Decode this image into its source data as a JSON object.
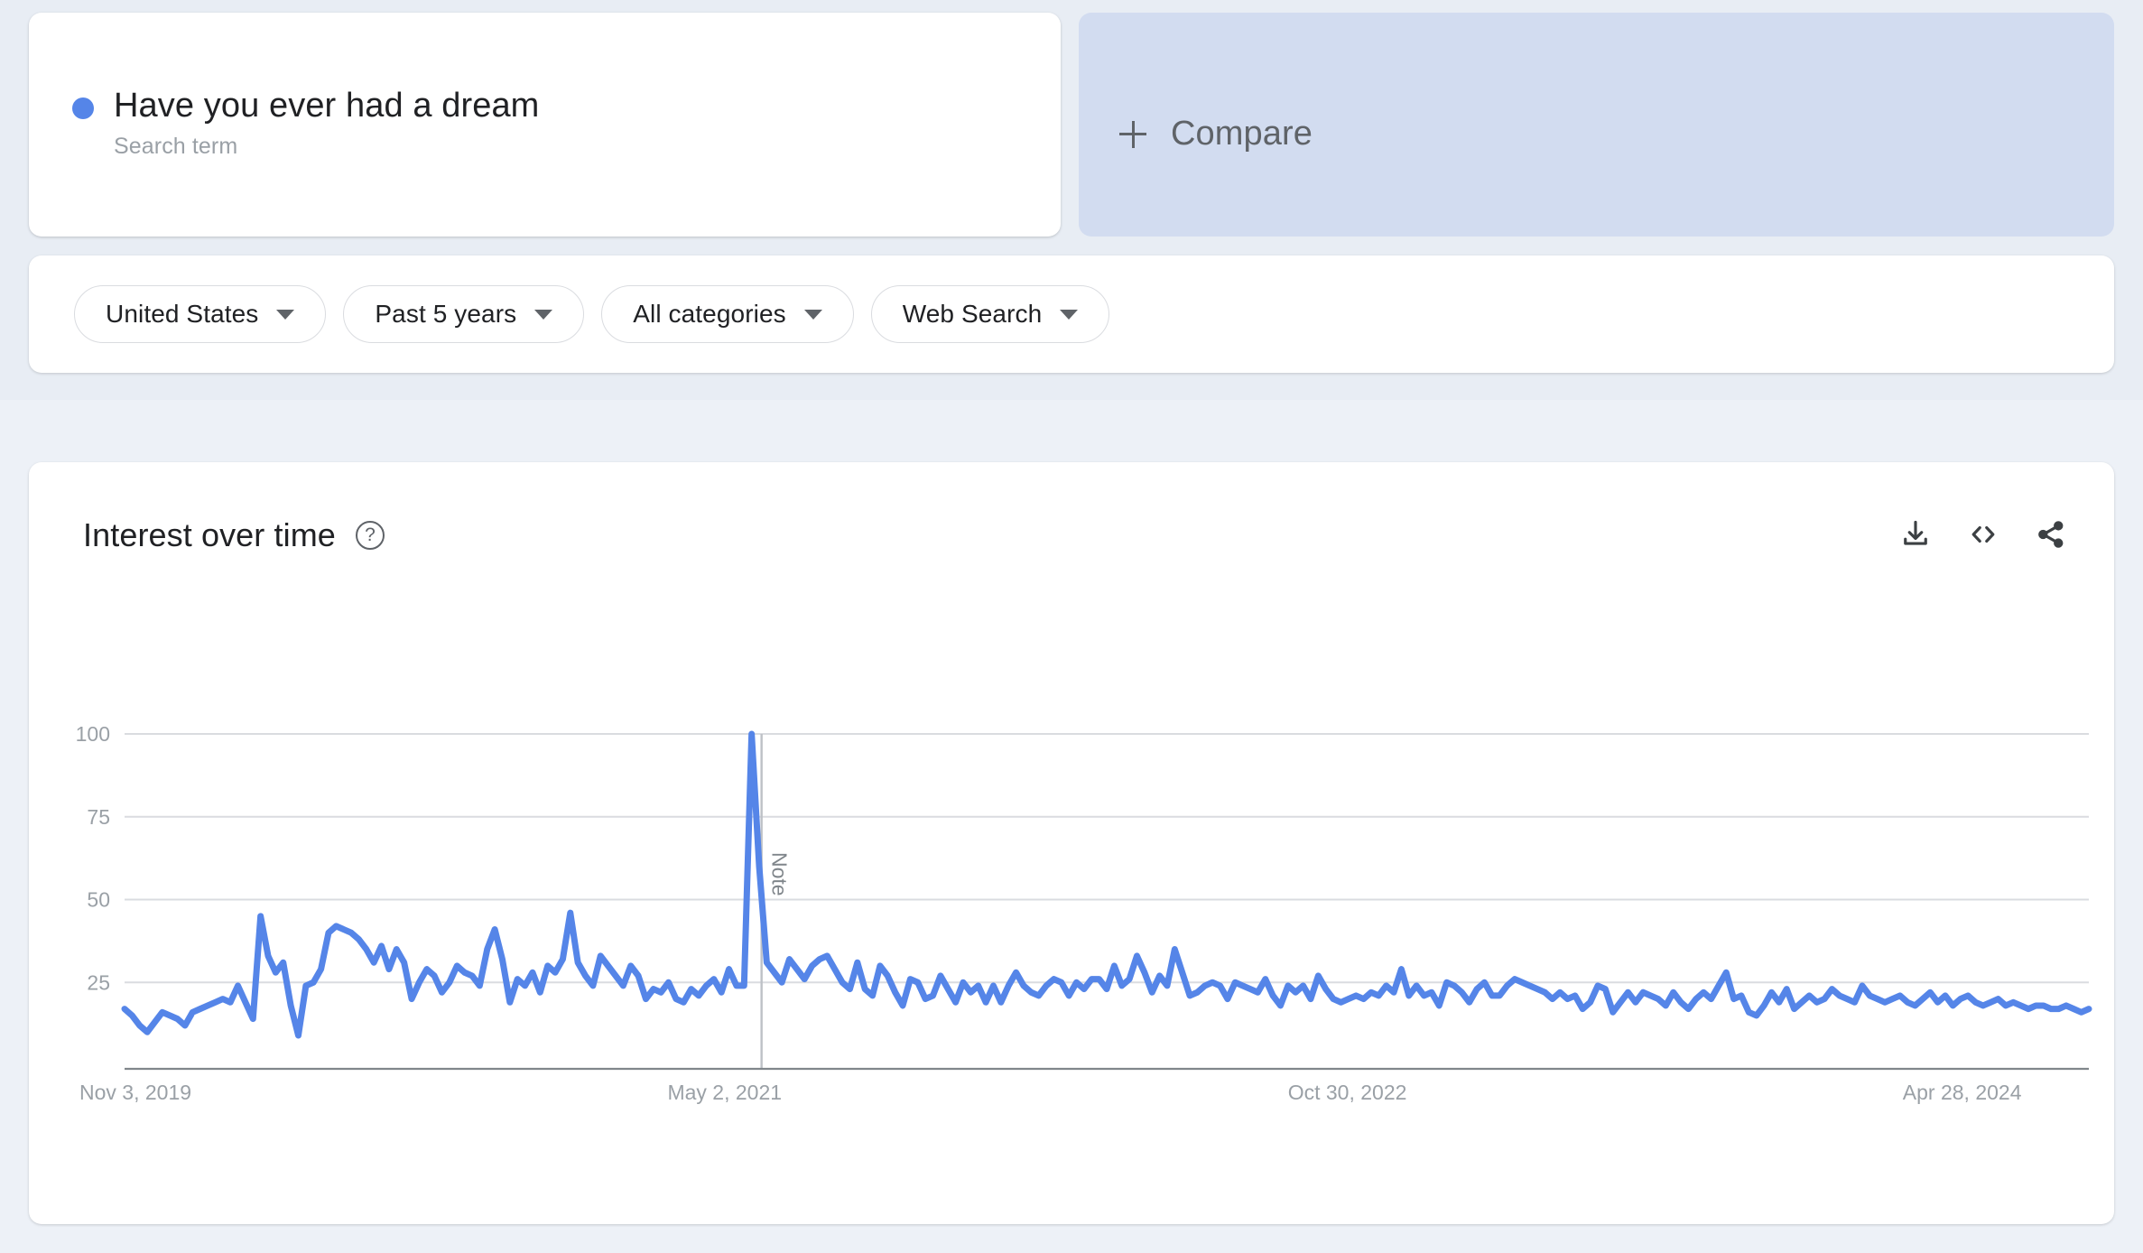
{
  "theme": {
    "background": "#e8edf3",
    "card_background": "#ffffff",
    "compare_background": "#d2dcf0",
    "series_color": "#5585e8",
    "text_primary": "#202124",
    "text_secondary": "#5f6368",
    "text_muted": "#9aa0a6",
    "gridline": "#dadce0"
  },
  "term": {
    "title": "Have you ever had a dream",
    "subtitle": "Search term",
    "dot_color": "#5585e8"
  },
  "compare": {
    "label": "Compare",
    "plus_icon": "plus-icon"
  },
  "filters": [
    {
      "label": "United States",
      "caret": "chevron-down-icon",
      "name": "region"
    },
    {
      "label": "Past 5 years",
      "caret": "chevron-down-icon",
      "name": "time-range"
    },
    {
      "label": "All categories",
      "caret": "chevron-down-icon",
      "name": "category"
    },
    {
      "label": "Web Search",
      "caret": "chevron-down-icon",
      "name": "search-type"
    }
  ],
  "chart_panel": {
    "title": "Interest over time",
    "help_icon": "help-circle-icon",
    "help_glyph": "?",
    "actions": [
      {
        "name": "download-icon",
        "label": "Download"
      },
      {
        "name": "embed-code-icon",
        "label": "Embed"
      },
      {
        "name": "share-icon",
        "label": "Share"
      }
    ]
  },
  "chart_data": {
    "type": "line",
    "title": "Interest over time",
    "xlabel": "",
    "ylabel": "",
    "ylim": [
      0,
      100
    ],
    "yticks": [
      100,
      75,
      50,
      25
    ],
    "grid": true,
    "legend": false,
    "xticks": [
      "Nov 3, 2019",
      "May 2, 2021",
      "Oct 30, 2022",
      "Apr 28, 2024"
    ],
    "xtick_positions": [
      0,
      0.5195,
      1.039,
      1.5585
    ],
    "xtick_unit": "fraction of 261 weekly points (tick 2,3,4 extrapolated beyond index range scale)",
    "annotations": [
      {
        "type": "vertical-line",
        "label": "Note",
        "x_index": 83,
        "color": "#bdc1c6"
      }
    ],
    "series": [
      {
        "name": "Have you ever had a dream",
        "color": "#5585e8",
        "values": [
          17,
          15,
          12,
          10,
          13,
          16,
          15,
          14,
          12,
          16,
          17,
          18,
          19,
          20,
          19,
          24,
          19,
          14,
          45,
          33,
          28,
          31,
          18,
          9,
          24,
          25,
          29,
          40,
          42,
          41,
          40,
          38,
          35,
          31,
          36,
          29,
          35,
          31,
          20,
          25,
          29,
          27,
          22,
          25,
          30,
          28,
          27,
          24,
          35,
          41,
          32,
          19,
          26,
          24,
          28,
          22,
          30,
          28,
          32,
          46,
          31,
          27,
          24,
          33,
          30,
          27,
          24,
          30,
          27,
          20,
          23,
          22,
          25,
          20,
          19,
          23,
          21,
          24,
          26,
          22,
          29,
          24,
          24,
          100,
          60,
          31,
          28,
          25,
          32,
          29,
          26,
          30,
          32,
          33,
          29,
          25,
          23,
          31,
          23,
          21,
          30,
          27,
          22,
          18,
          26,
          25,
          20,
          21,
          27,
          23,
          19,
          25,
          22,
          24,
          19,
          24,
          19,
          24,
          28,
          24,
          22,
          21,
          24,
          26,
          25,
          21,
          25,
          23,
          26,
          26,
          23,
          30,
          24,
          26,
          33,
          28,
          22,
          27,
          24,
          35,
          28,
          21,
          22,
          24,
          25,
          24,
          20,
          25,
          24,
          23,
          22,
          26,
          21,
          18,
          24,
          22,
          24,
          20,
          27,
          23,
          20,
          19,
          20,
          21,
          20,
          22,
          21,
          24,
          22,
          29,
          21,
          24,
          21,
          22,
          18,
          25,
          24,
          22,
          19,
          23,
          25,
          21,
          21,
          24,
          26,
          25,
          24,
          23,
          22,
          20,
          22,
          20,
          21,
          17,
          19,
          24,
          23,
          16,
          19,
          22,
          19,
          22,
          21,
          20,
          18,
          22,
          19,
          17,
          20,
          22,
          20,
          24,
          28,
          20,
          21,
          16,
          15,
          18,
          22,
          19,
          23,
          17,
          19,
          21,
          19,
          20,
          23,
          21,
          20,
          19,
          24,
          21,
          20,
          19,
          20,
          21,
          19,
          18,
          20,
          22,
          19,
          21,
          18,
          20,
          21,
          19,
          18,
          19,
          20,
          18,
          19,
          18,
          17,
          18,
          18,
          17,
          17,
          18,
          17,
          16,
          17
        ]
      }
    ]
  }
}
